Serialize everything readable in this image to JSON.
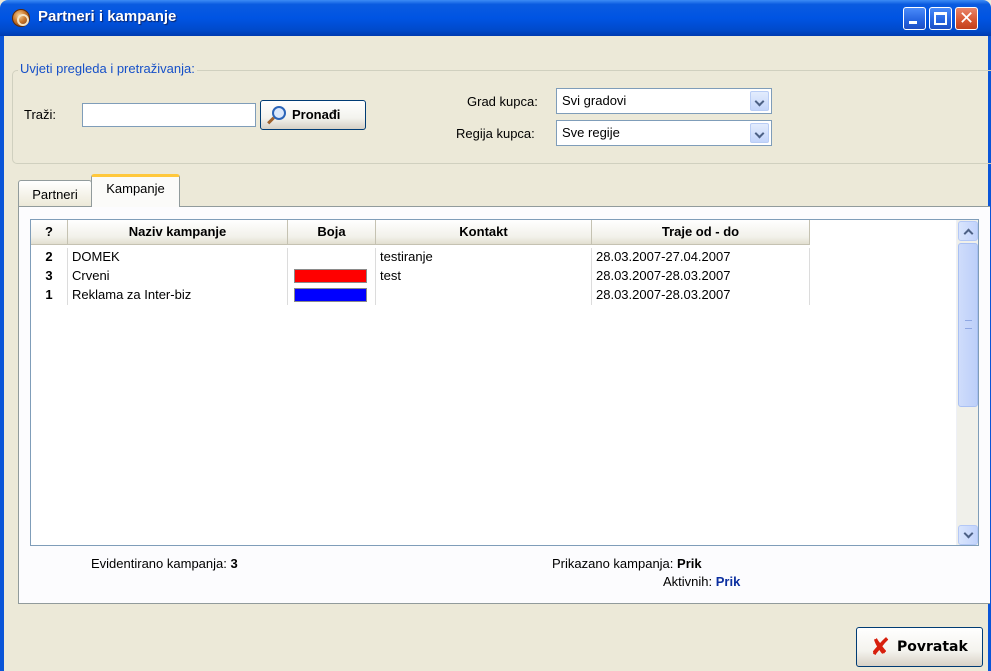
{
  "window": {
    "title": "Partneri i kampanje",
    "icon": "app-icon",
    "controls": [
      "minimize-icon",
      "maximize-icon",
      "close-icon"
    ]
  },
  "filters": {
    "legend": "Uvjeti pregleda i pretraživanja:",
    "search_label": "Traži:",
    "search_value": "",
    "find_button": "Pronađi",
    "city_label": "Grad kupca:",
    "city_value": "Svi gradovi",
    "region_label": "Regija kupca:",
    "region_value": "Sve regije"
  },
  "tabs": [
    {
      "label": "Partneri",
      "active": false
    },
    {
      "label": "Kampanje",
      "active": true
    }
  ],
  "grid": {
    "columns": [
      "?",
      "Naziv kampanje",
      "Boja",
      "Kontakt",
      "Traje od - do"
    ],
    "rows": [
      {
        "id": "2",
        "name": "DOMEK",
        "color": "",
        "contact": "testiranje",
        "period": "28.03.2007-27.04.2007"
      },
      {
        "id": "3",
        "name": "Crveni",
        "color": "#ff0000",
        "contact": "test",
        "period": "28.03.2007-28.03.2007"
      },
      {
        "id": "1",
        "name": "Reklama za Inter-biz",
        "color": "#0000ff",
        "contact": "",
        "period": "28.03.2007-28.03.2007"
      }
    ]
  },
  "summary": {
    "registered_label": "Evidentirano kampanja:",
    "registered_value": "3",
    "shown_label": "Prikazano kampanja:",
    "shown_value": "Prik",
    "active_label": "Aktivnih:",
    "active_value": "Prik"
  },
  "back_button": "Povratak",
  "colors": {
    "titlebar": "#0054e3",
    "legend_text": "#1650c8",
    "tab_highlight": "#ffc83c",
    "active_value": "#0b2fa0"
  }
}
